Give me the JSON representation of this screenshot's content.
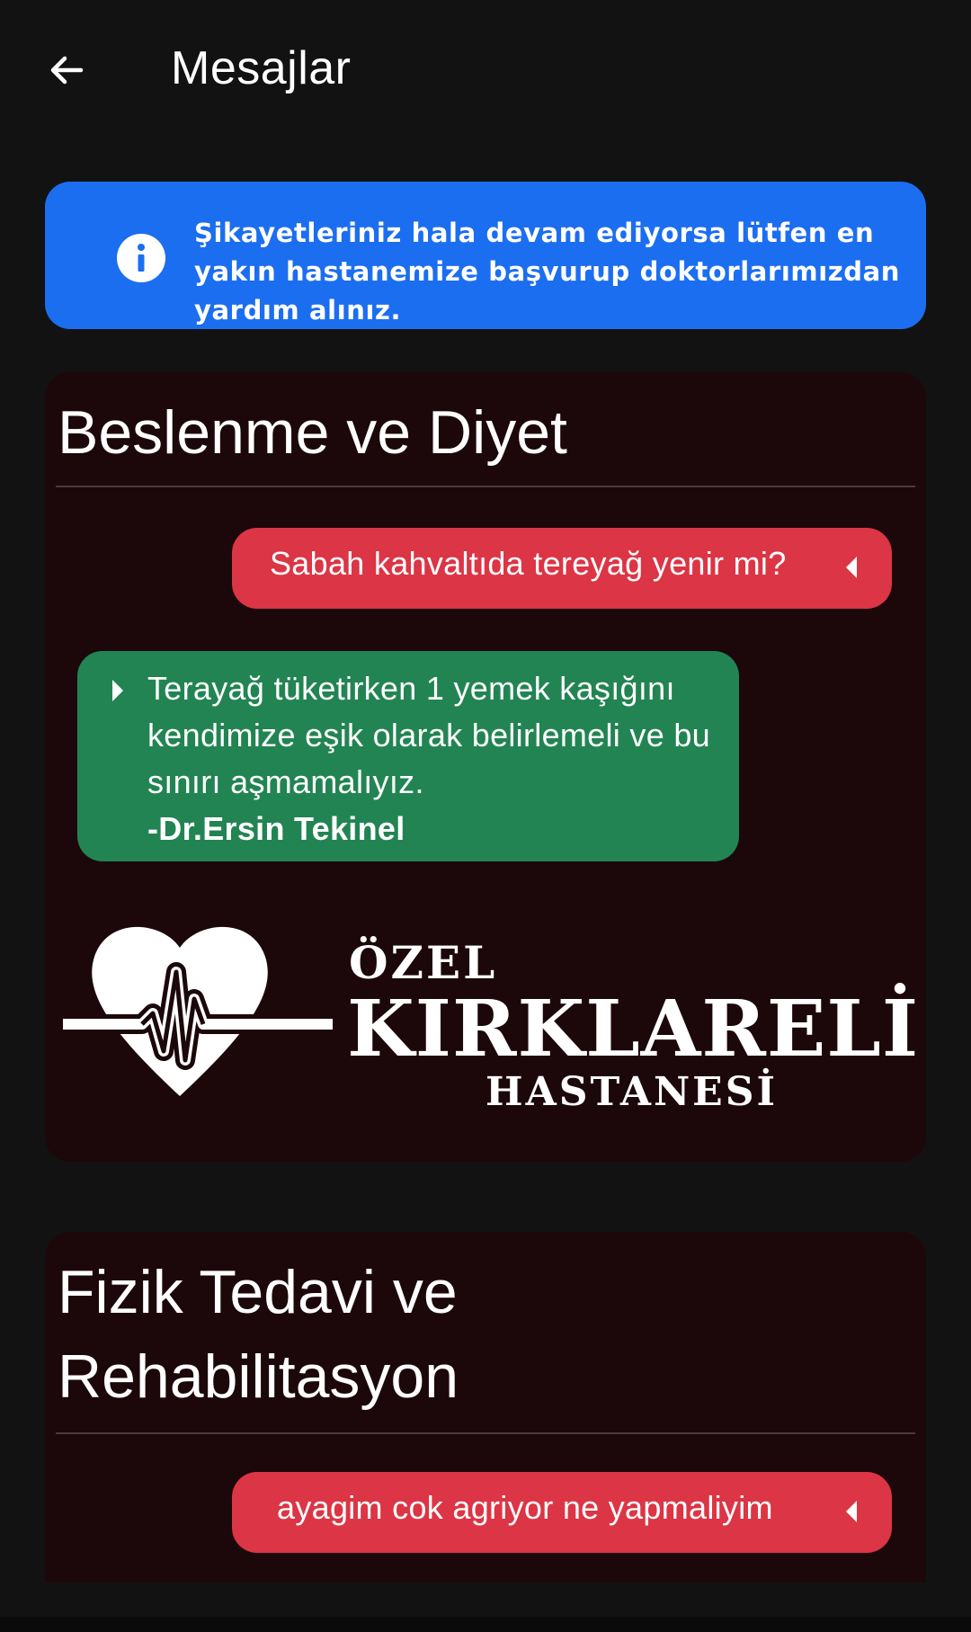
{
  "appbar": {
    "title": "Mesajlar",
    "back_icon": "arrow-back-icon"
  },
  "banner": {
    "icon": "info-icon",
    "text": "Şikayetleriniz hala devam ediyorsa lütfen en yakın hastanemize başvurup doktorlarımızdan yardım alınız.",
    "color": "#1c6ef0"
  },
  "colors": {
    "background": "#121212",
    "card": "#1c080b",
    "question": "#dc3545",
    "answer": "#228453"
  },
  "categories": [
    {
      "title": "Beslenme ve Diyet",
      "question": "Sabah kahvaltıda tereyağ yenir mi?",
      "answer": {
        "text": "Terayağ tüketirken 1 yemek kaşığını kendimize eşik olarak belirlemeli ve bu sınırı aşmamalıyız.",
        "author": "-Dr.Ersin Tekinel"
      },
      "logo": {
        "line1": "ÖZEL",
        "line2": "KIRKLARELİ",
        "line3": "HASTANESİ",
        "icon": "heart-pulse-icon"
      }
    },
    {
      "title": "Fizik Tedavi ve Rehabilitasyon",
      "question": "ayagim cok agriyor ne yapmaliyim"
    }
  ]
}
